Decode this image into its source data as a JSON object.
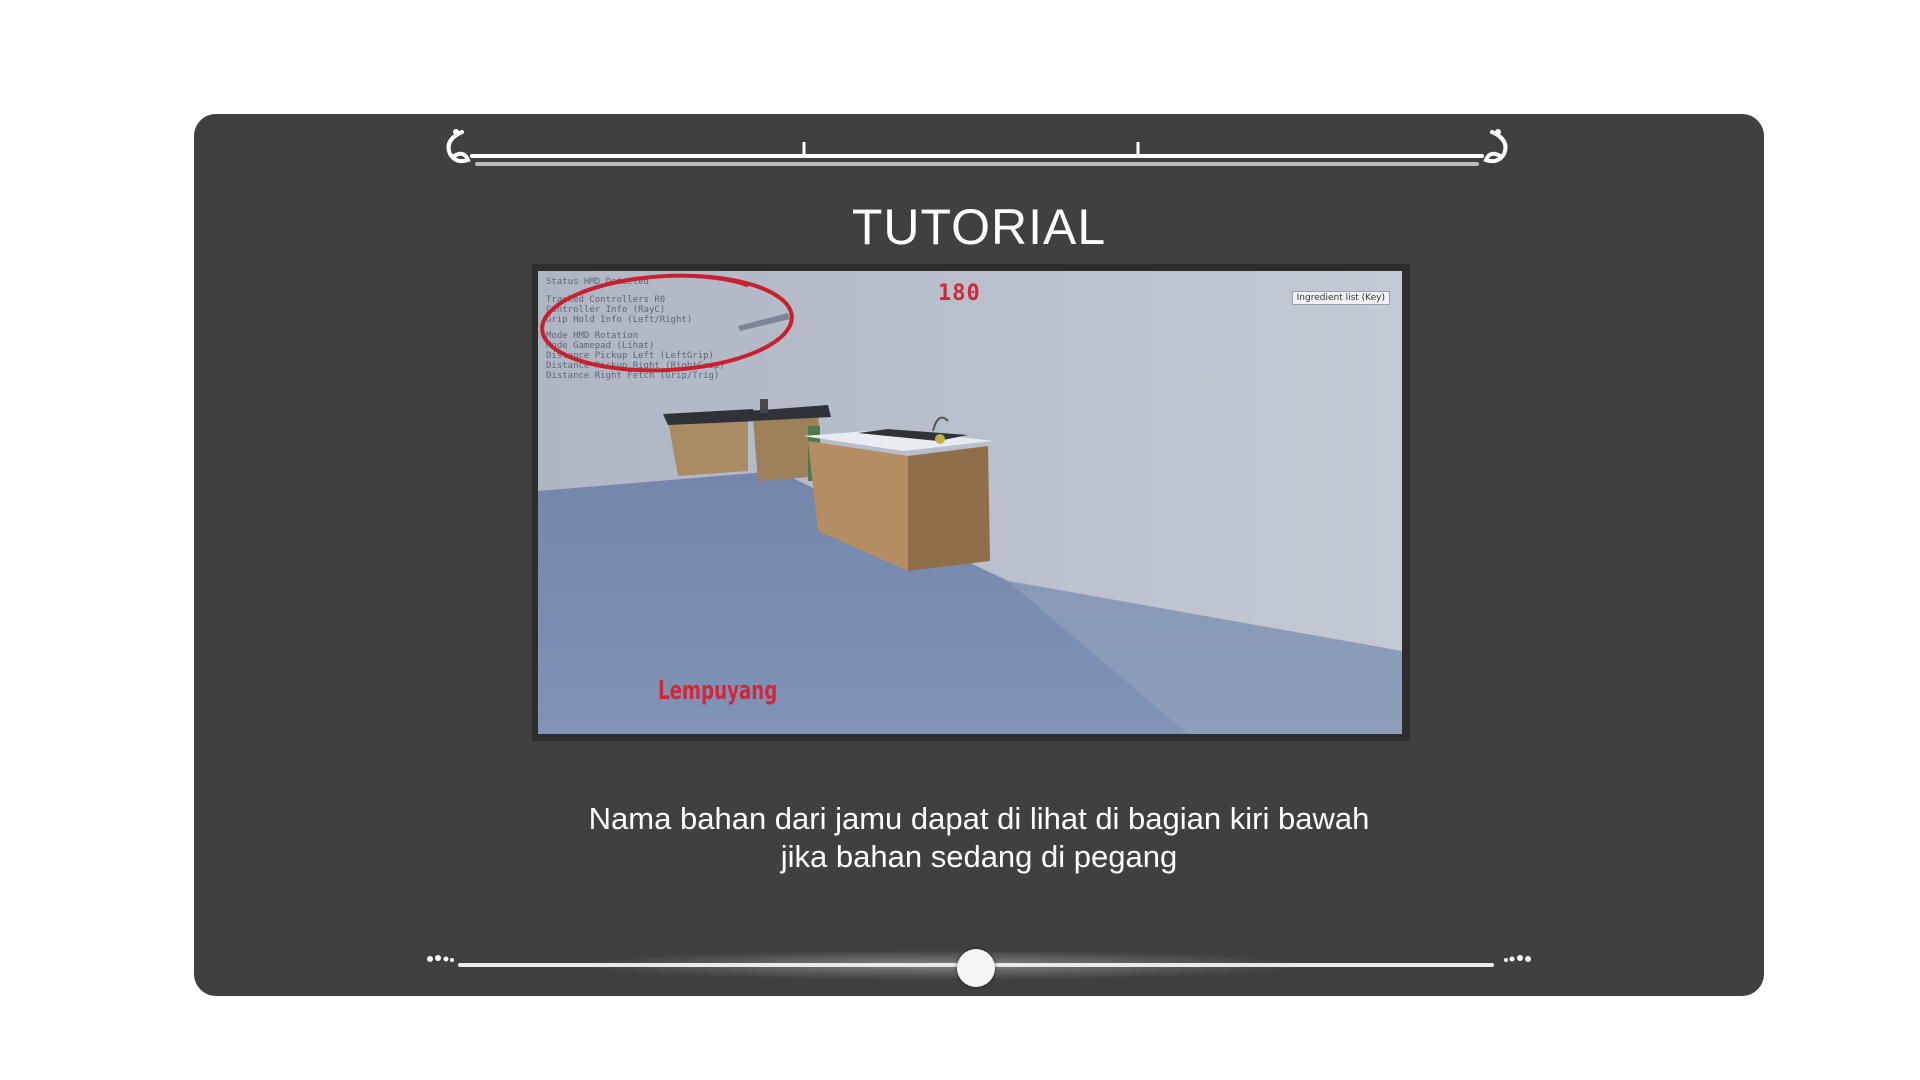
{
  "title": "TUTORIAL",
  "video": {
    "timer": "180",
    "corner_button": "Ingredient list (Key)",
    "ingredient_label": "Lempuyang",
    "hud_lines": [
      "Status   HMD Detected",
      "Tracked Controllers  R0",
      "Controller Info   (RayC)",
      "Grip Hold Info   (Left/Right)",
      "Mode   HMD Rotation",
      "Mode Gamepad   (Lihat)",
      "Distance Pickup Left  (LeftGrip)",
      "Distance Pickup Right (RightGrip)",
      "Distance Right Fetch  (Grip/Trig)"
    ]
  },
  "caption": {
    "line1": "Nama bahan dari jamu dapat di lihat di bagian kiri bawah",
    "line2": "jika bahan sedang di pegang"
  },
  "slider": {
    "progress": 0.5
  },
  "colors": {
    "panel": "#404040",
    "accent_red": "#d0283a",
    "text": "#ffffff"
  }
}
